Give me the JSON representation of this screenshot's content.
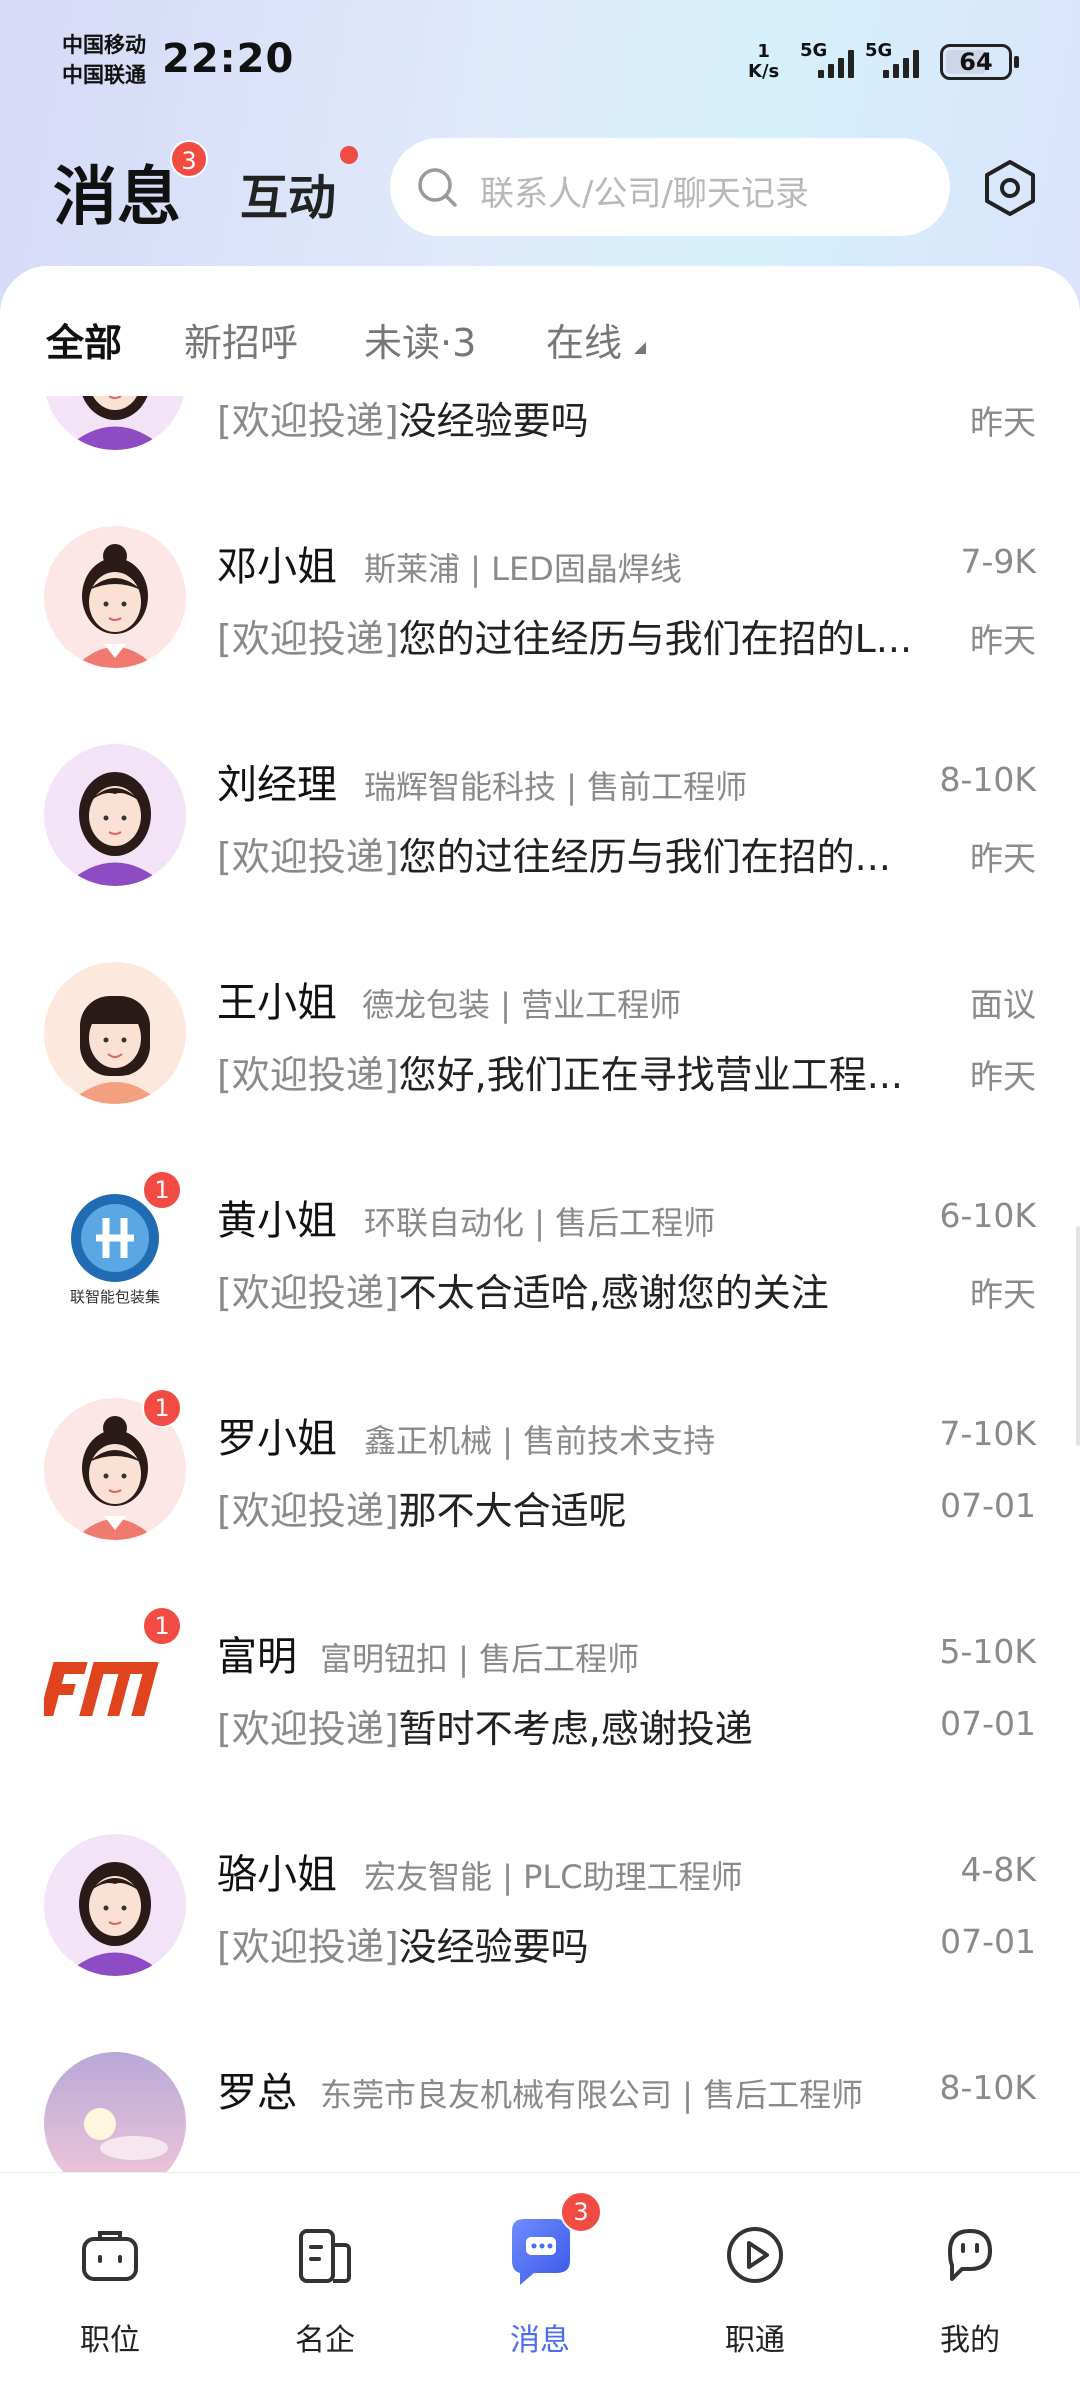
{
  "status_bar": {
    "carrier1": "中国移动",
    "carrier2": "中国联通",
    "time": "22:20",
    "net_speed_value": "1",
    "net_speed_unit": "K/s",
    "signal1": "5G",
    "signal2": "5G",
    "battery": "64"
  },
  "header": {
    "title": "消息",
    "title_badge": "3",
    "interact": "互动",
    "search_placeholder": "联系人/公司/聊天记录"
  },
  "tabs": [
    {
      "label": "全部",
      "active": true
    },
    {
      "label": "新招呼",
      "active": false
    },
    {
      "label": "未读·3",
      "active": false
    },
    {
      "label": "在线",
      "active": false
    }
  ],
  "conversations": [
    {
      "name": "",
      "company": "",
      "salary": "",
      "tag": "[欢迎投递]",
      "message": "没经验要吗",
      "time": "昨天",
      "unread": "",
      "avatar": "woman-purple"
    },
    {
      "name": "邓小姐",
      "company": "斯莱浦 | LED固晶焊线",
      "salary": "7-9K",
      "tag": "[欢迎投递]",
      "message": "您的过往经历与我们在招的L...",
      "time": "昨天",
      "unread": "",
      "avatar": "woman-bun"
    },
    {
      "name": "刘经理",
      "company": "瑞辉智能科技 | 售前工程师",
      "salary": "8-10K",
      "tag": "[欢迎投递]",
      "message": "您的过往经历与我们在招的...",
      "time": "昨天",
      "unread": "",
      "avatar": "woman-purple"
    },
    {
      "name": "王小姐",
      "company": "德龙包装 | 营业工程师",
      "salary": "面议",
      "tag": "[欢迎投递]",
      "message": "您好,我们正在寻找营业工程...",
      "time": "昨天",
      "unread": "",
      "avatar": "woman-bangs"
    },
    {
      "name": "黄小姐",
      "company": "环联自动化 | 售后工程师",
      "salary": "6-10K",
      "tag": "[欢迎投递]",
      "message": "不太合适哈,感谢您的关注",
      "time": "昨天",
      "unread": "1",
      "avatar": "logo-huanlian",
      "logo_text": "联智能包装集"
    },
    {
      "name": "罗小姐",
      "company": "鑫正机械 | 售前技术支持",
      "salary": "7-10K",
      "tag": "[欢迎投递]",
      "message": "那不大合适呢",
      "time": "07-01",
      "unread": "1",
      "avatar": "woman-bun"
    },
    {
      "name": "富明",
      "company": "富明钮扣 | 售后工程师",
      "salary": "5-10K",
      "tag": "[欢迎投递]",
      "message": "暂时不考虑,感谢投递",
      "time": "07-01",
      "unread": "1",
      "avatar": "logo-fm"
    },
    {
      "name": "骆小姐",
      "company": "宏友智能 | PLC助理工程师",
      "salary": "4-8K",
      "tag": "[欢迎投递]",
      "message": "没经验要吗",
      "time": "07-01",
      "unread": "",
      "avatar": "woman-purple"
    },
    {
      "name": "罗总",
      "company": "东莞市良友机械有限公司 | 售后工程师",
      "salary": "8-10K",
      "tag": "",
      "message": "",
      "time": "",
      "unread": "",
      "avatar": "photo-moon"
    }
  ],
  "bottom_nav": [
    {
      "label": "职位",
      "icon": "briefcase-icon",
      "active": false,
      "badge": ""
    },
    {
      "label": "名企",
      "icon": "company-icon",
      "active": false,
      "badge": ""
    },
    {
      "label": "消息",
      "icon": "message-icon",
      "active": true,
      "badge": "3"
    },
    {
      "label": "职通",
      "icon": "play-icon",
      "active": false,
      "badge": ""
    },
    {
      "label": "我的",
      "icon": "profile-icon",
      "active": false,
      "badge": ""
    }
  ],
  "colors": {
    "accent": "#4a6cf5",
    "badge": "#f24b43",
    "muted": "#8a8a8a"
  }
}
